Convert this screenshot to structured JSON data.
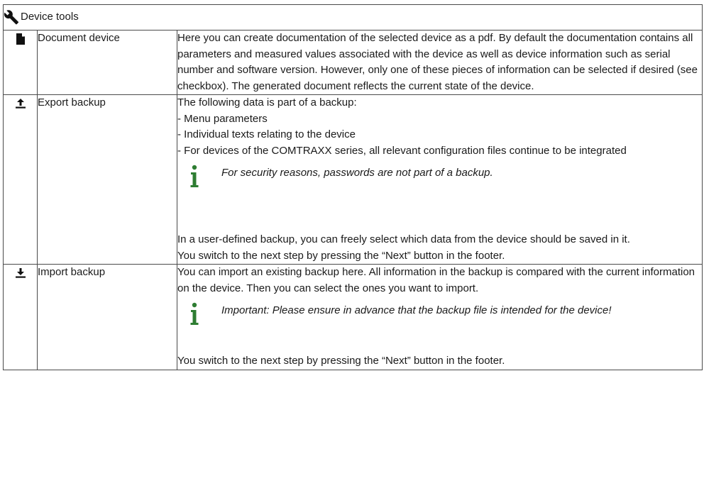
{
  "header": {
    "title": "Device tools",
    "icon": "wrench-icon"
  },
  "rows": [
    {
      "icon": "document-icon",
      "name": "Document device",
      "description": "Here you can create documentation of the selected device as a pdf. By default the documentation contains all parameters and measured values associated with the device as well as device information such as serial number and software version. However, only one of these pieces of information can be selected if desired (see checkbox). The generated document reflects the current state of the device."
    },
    {
      "icon": "upload-icon",
      "name": "Export backup",
      "intro": "The following data is part of a backup:",
      "items": [
        "- Menu parameters",
        "- Individual texts relating to the device",
        "- For devices of the COMTRAXX series, all relevant configuration files continue to be integrated"
      ],
      "note": "For security reasons, passwords are not part of a backup.",
      "after": "In a user-defined backup, you can freely select which data from the device should be saved in it.",
      "next": "You switch to the next step by pressing the “Next” button in the footer."
    },
    {
      "icon": "download-icon",
      "name": "Import backup",
      "intro": "You can import an existing backup here. All information in the backup is compared with the current information on the device. Then you can select the ones you want to import.",
      "note": "Important: Please ensure in advance that the backup file is intended for the device!",
      "next": "You switch to the next step by pressing the “Next” button in the footer."
    }
  ],
  "colors": {
    "info_icon": "#2e7d32",
    "border": "#4a4a4a"
  }
}
